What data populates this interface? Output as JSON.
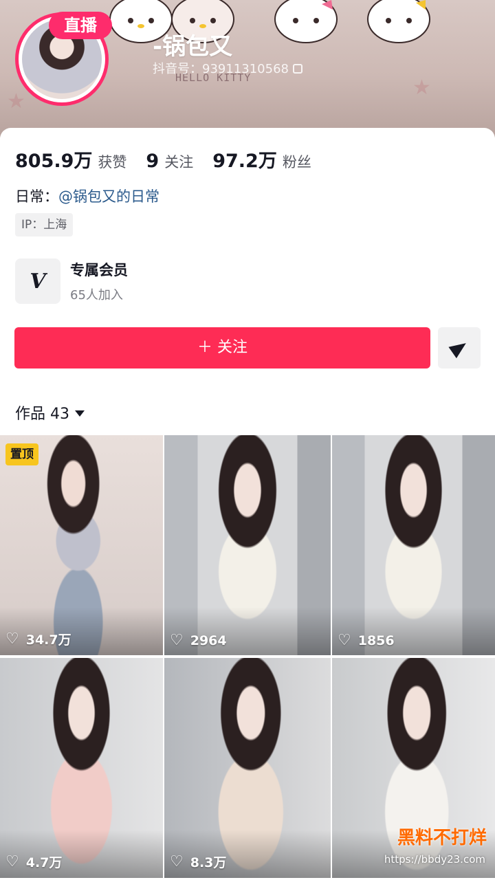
{
  "header": {
    "live_badge": "直播",
    "nickname": "-锅包又",
    "douyin_id": "抖音号：93911310568",
    "banner_text": "HELLO KITTY"
  },
  "stats": [
    {
      "num": "805.9万",
      "label": "获赞"
    },
    {
      "num": "9",
      "label": "关注"
    },
    {
      "num": "97.2万",
      "label": "粉丝"
    }
  ],
  "bio": {
    "daily_prefix": "日常：",
    "daily_link": "@锅包又的日常",
    "ip": "IP：上海"
  },
  "member": {
    "icon_letter": "V",
    "title": "专属会员",
    "subtitle": "65人加入"
  },
  "actions": {
    "follow_label": "＋ 关注",
    "share_icon": "paper-plane-icon"
  },
  "works": {
    "label": "作品 43",
    "items": [
      {
        "likes": "34.7万",
        "pinned": "置顶"
      },
      {
        "likes": "2964"
      },
      {
        "likes": "1856"
      },
      {
        "likes": "4.7万"
      },
      {
        "likes": "8.3万"
      },
      {
        "likes": ""
      }
    ]
  },
  "watermark": {
    "text": "黑料不打烊",
    "url": "https://bbdy23.com"
  },
  "colors": {
    "accent": "#fe2c55",
    "live_ring": "#fe2c6c",
    "pin_badge": "#f7c51e",
    "link": "#2b5a8c"
  }
}
